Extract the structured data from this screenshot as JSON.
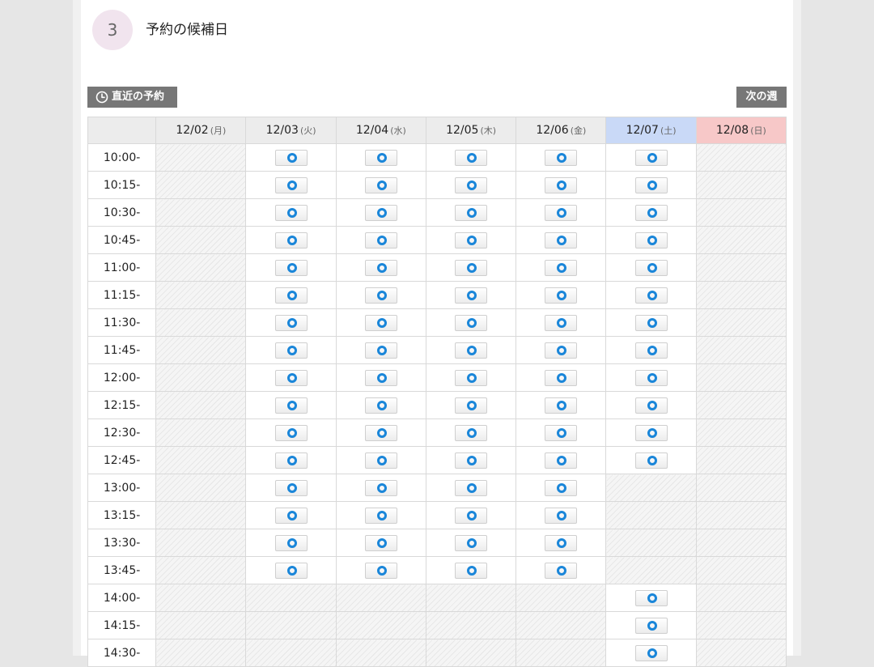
{
  "step": {
    "number": "3",
    "title": "予約の候補日"
  },
  "nav": {
    "recent_label": "直近の予約",
    "next_label": "次の週"
  },
  "colors": {
    "saturday_header": "#c9d9f7",
    "sunday_header": "#f7c8c8",
    "available_mark": "#1a86d9"
  },
  "available_symbol": "circle-icon",
  "days": [
    {
      "date": "12/02",
      "weekday": "(月)",
      "type": "weekday"
    },
    {
      "date": "12/03",
      "weekday": "(火)",
      "type": "weekday"
    },
    {
      "date": "12/04",
      "weekday": "(水)",
      "type": "weekday"
    },
    {
      "date": "12/05",
      "weekday": "(木)",
      "type": "weekday"
    },
    {
      "date": "12/06",
      "weekday": "(金)",
      "type": "weekday"
    },
    {
      "date": "12/07",
      "weekday": "(土)",
      "type": "sat"
    },
    {
      "date": "12/08",
      "weekday": "(日)",
      "type": "sun"
    }
  ],
  "rows": [
    {
      "time": "10:00-",
      "slots": [
        false,
        true,
        true,
        true,
        true,
        true,
        false
      ]
    },
    {
      "time": "10:15-",
      "slots": [
        false,
        true,
        true,
        true,
        true,
        true,
        false
      ]
    },
    {
      "time": "10:30-",
      "slots": [
        false,
        true,
        true,
        true,
        true,
        true,
        false
      ]
    },
    {
      "time": "10:45-",
      "slots": [
        false,
        true,
        true,
        true,
        true,
        true,
        false
      ]
    },
    {
      "time": "11:00-",
      "slots": [
        false,
        true,
        true,
        true,
        true,
        true,
        false
      ]
    },
    {
      "time": "11:15-",
      "slots": [
        false,
        true,
        true,
        true,
        true,
        true,
        false
      ]
    },
    {
      "time": "11:30-",
      "slots": [
        false,
        true,
        true,
        true,
        true,
        true,
        false
      ]
    },
    {
      "time": "11:45-",
      "slots": [
        false,
        true,
        true,
        true,
        true,
        true,
        false
      ]
    },
    {
      "time": "12:00-",
      "slots": [
        false,
        true,
        true,
        true,
        true,
        true,
        false
      ]
    },
    {
      "time": "12:15-",
      "slots": [
        false,
        true,
        true,
        true,
        true,
        true,
        false
      ]
    },
    {
      "time": "12:30-",
      "slots": [
        false,
        true,
        true,
        true,
        true,
        true,
        false
      ]
    },
    {
      "time": "12:45-",
      "slots": [
        false,
        true,
        true,
        true,
        true,
        true,
        false
      ]
    },
    {
      "time": "13:00-",
      "slots": [
        false,
        true,
        true,
        true,
        true,
        false,
        false
      ]
    },
    {
      "time": "13:15-",
      "slots": [
        false,
        true,
        true,
        true,
        true,
        false,
        false
      ]
    },
    {
      "time": "13:30-",
      "slots": [
        false,
        true,
        true,
        true,
        true,
        false,
        false
      ]
    },
    {
      "time": "13:45-",
      "slots": [
        false,
        true,
        true,
        true,
        true,
        false,
        false
      ]
    },
    {
      "time": "14:00-",
      "slots": [
        false,
        false,
        false,
        false,
        false,
        true,
        false
      ]
    },
    {
      "time": "14:15-",
      "slots": [
        false,
        false,
        false,
        false,
        false,
        true,
        false
      ]
    },
    {
      "time": "14:30-",
      "slots": [
        false,
        false,
        false,
        false,
        false,
        true,
        false
      ]
    }
  ]
}
